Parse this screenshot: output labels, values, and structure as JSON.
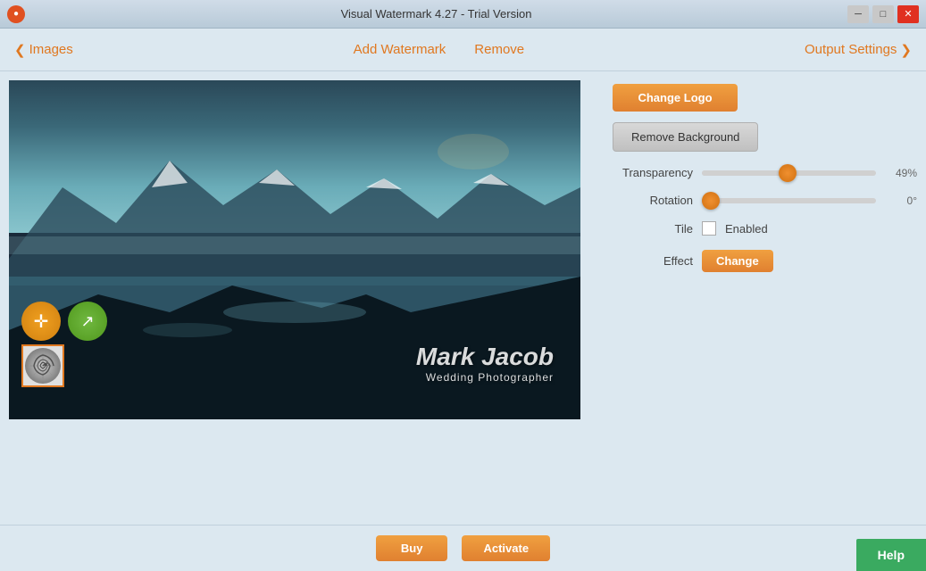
{
  "titlebar": {
    "title": "Visual Watermark 4.27 - Trial Version",
    "icon": "●",
    "min_label": "─",
    "max_label": "□",
    "close_label": "✕"
  },
  "navbar": {
    "back_arrow": "❮",
    "images_label": "Images",
    "add_watermark_label": "Add Watermark",
    "remove_label": "Remove",
    "output_settings_label": "Output Settings",
    "forward_arrow": "❯"
  },
  "right_panel": {
    "change_logo_label": "Change Logo",
    "remove_bg_label": "Remove Background",
    "transparency_label": "Transparency",
    "transparency_value": "49%",
    "transparency_pct": 49,
    "rotation_label": "Rotation",
    "rotation_value": "0°",
    "rotation_pct": 2,
    "tile_label": "Tile",
    "tile_enabled_label": "Enabled",
    "effect_label": "Effect",
    "change_effect_label": "Change"
  },
  "watermark": {
    "first_name": "Mark",
    "last_name": " Jacob",
    "subtitle": "Wedding Photographer"
  },
  "bottom_bar": {
    "buy_label": "Buy",
    "activate_label": "Activate",
    "help_label": "Help"
  }
}
